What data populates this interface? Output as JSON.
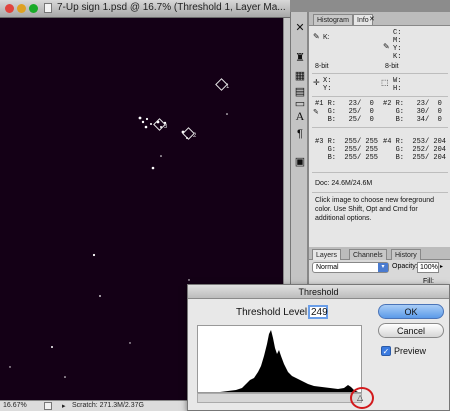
{
  "document": {
    "title": "7-Up sign 1.psd @ 16.7% (Threshold 1, Layer Ma...",
    "zoom": "16.67%",
    "status": "Scratch: 271.3M/2.37G",
    "marker_labels": [
      "1",
      "2",
      "3"
    ]
  },
  "info_panel": {
    "tabs": [
      "Histogram",
      "Info"
    ],
    "cmyk_labels": "C:\nM:\nY:\nK:",
    "k_label": "K:",
    "bits_left": "8-bit",
    "bits_right": "8-bit",
    "xy": "X:\nY:",
    "wh": "W:\nH:",
    "s1": "#1 R:   23/  0\n   G:   25/  0\n   B:   25/  0",
    "s2": "#2 R:   23/  0\n   G:   30/  0\n   B:   34/  0",
    "s3": "#3 R:  255/ 255\n   G:  255/ 255\n   B:  255/ 255",
    "s4": "#4 R:  253/ 204\n   G:  252/ 204\n   B:  255/ 204",
    "doc": "Doc: 24.6M/24.6M",
    "hint": "Click image to choose new foreground color.  Use Shift, Opt and Cmd for additional options."
  },
  "layers_panel": {
    "tabs": [
      "Layers",
      "Channels",
      "History"
    ],
    "blend_mode": "Normal",
    "opacity_label": "Opacity:",
    "opacity": "100%",
    "fill_label": "Fill:"
  },
  "threshold": {
    "title": "Threshold",
    "level_label": "Threshold Level:",
    "level": "249",
    "ok": "OK",
    "cancel": "Cancel",
    "preview": "Preview",
    "preview_checked": true
  }
}
